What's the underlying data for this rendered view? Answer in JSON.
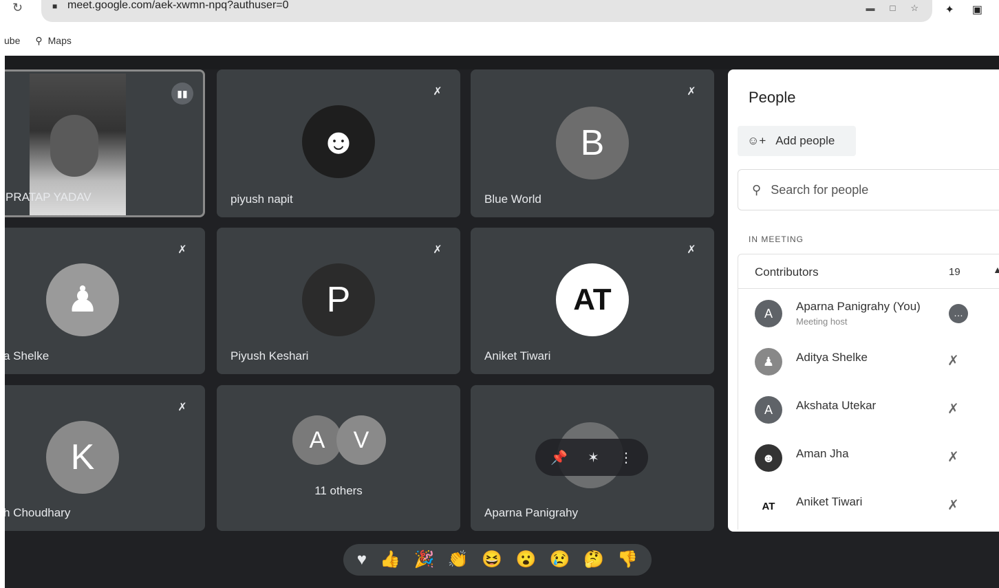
{
  "browser": {
    "url": "meet.google.com/aek-xwmn-npq?authuser=0",
    "bookmarks": [
      "ube",
      "Maps"
    ]
  },
  "tiles": [
    {
      "name": "PRATAP YADAV",
      "muted": false,
      "speaking": true
    },
    {
      "name": "piyush napit",
      "muted": true
    },
    {
      "name": "Blue World",
      "initial": "B",
      "muted": true
    },
    {
      "name": "a Shelke",
      "muted": true
    },
    {
      "name": "Piyush Keshari",
      "initial": "P",
      "muted": true
    },
    {
      "name": "Aniket Tiwari",
      "muted": true
    },
    {
      "name": "h Choudhary",
      "initial": "K",
      "muted": true
    },
    {
      "name": "11 others",
      "initials": [
        "A",
        "V"
      ]
    },
    {
      "name": "Aparna Panigrahy"
    }
  ],
  "people_panel": {
    "title": "People",
    "add_people": "Add people",
    "search_placeholder": "Search for people",
    "section": "IN MEETING",
    "group": {
      "label": "Contributors",
      "count": "19"
    },
    "participants": [
      {
        "name": "Aparna Panigrahy (You)",
        "sub": "Meeting host",
        "initial": "A"
      },
      {
        "name": "Aditya Shelke",
        "initial": ""
      },
      {
        "name": "Akshata Utekar",
        "initial": "A"
      },
      {
        "name": "Aman Jha",
        "initial": ""
      },
      {
        "name": "Aniket Tiwari",
        "initial": "AT"
      }
    ]
  },
  "reactions": [
    "heart",
    "thumbs-up",
    "party-popper",
    "clap",
    "laugh",
    "surprised",
    "sad",
    "thinking",
    "thumbs-down"
  ],
  "colors": {
    "meet_bg": "#202124",
    "tile_bg": "#3c4043",
    "avatar_b": "#6d6d6d",
    "avatar_p": "#2b2b2b",
    "avatar_k": "#8a8a8a"
  }
}
